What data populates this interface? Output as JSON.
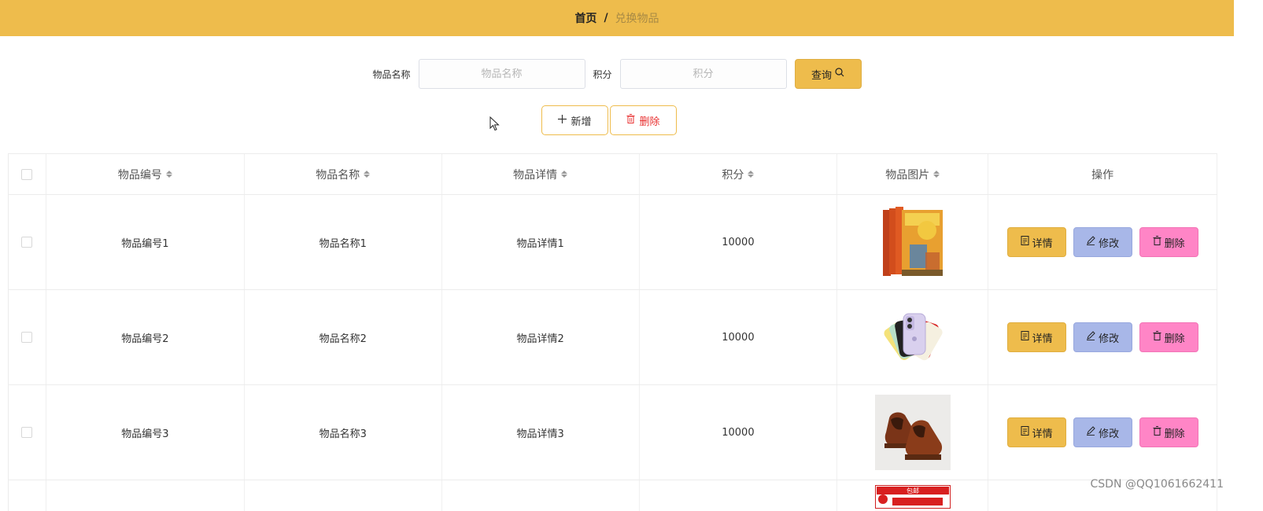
{
  "breadcrumb": {
    "home": "首页",
    "separator": "/",
    "current": "兑换物品"
  },
  "search": {
    "name_label": "物品名称",
    "name_placeholder": "物品名称",
    "points_label": "积分",
    "points_placeholder": "积分",
    "query_label": "查询"
  },
  "actions": {
    "add_label": "新增",
    "delete_label": "删除"
  },
  "table": {
    "columns": [
      "物品编号",
      "物品名称",
      "物品详情",
      "积分",
      "物品图片",
      "操作"
    ],
    "rows": [
      {
        "code": "物品编号1",
        "name": "物品名称1",
        "detail": "物品详情1",
        "points": "10000",
        "image": "book-image"
      },
      {
        "code": "物品编号2",
        "name": "物品名称2",
        "detail": "物品详情2",
        "points": "10000",
        "image": "phone-image"
      },
      {
        "code": "物品编号3",
        "name": "物品名称3",
        "detail": "物品详情3",
        "points": "10000",
        "image": "shoes-image"
      }
    ],
    "row_actions": {
      "detail": "详情",
      "edit": "修改",
      "remove": "删除"
    },
    "partial_row_badge": "包邮"
  },
  "watermark": "CSDN @QQ1061662411",
  "colors": {
    "accent": "#eebc4c",
    "edit": "#a8b7e8",
    "remove": "#ff85c6",
    "danger_text": "#e83030"
  },
  "icons": {
    "query": "search-icon",
    "add": "plus-icon",
    "delete": "trash-icon",
    "detail": "document-icon",
    "edit": "pencil-icon"
  }
}
